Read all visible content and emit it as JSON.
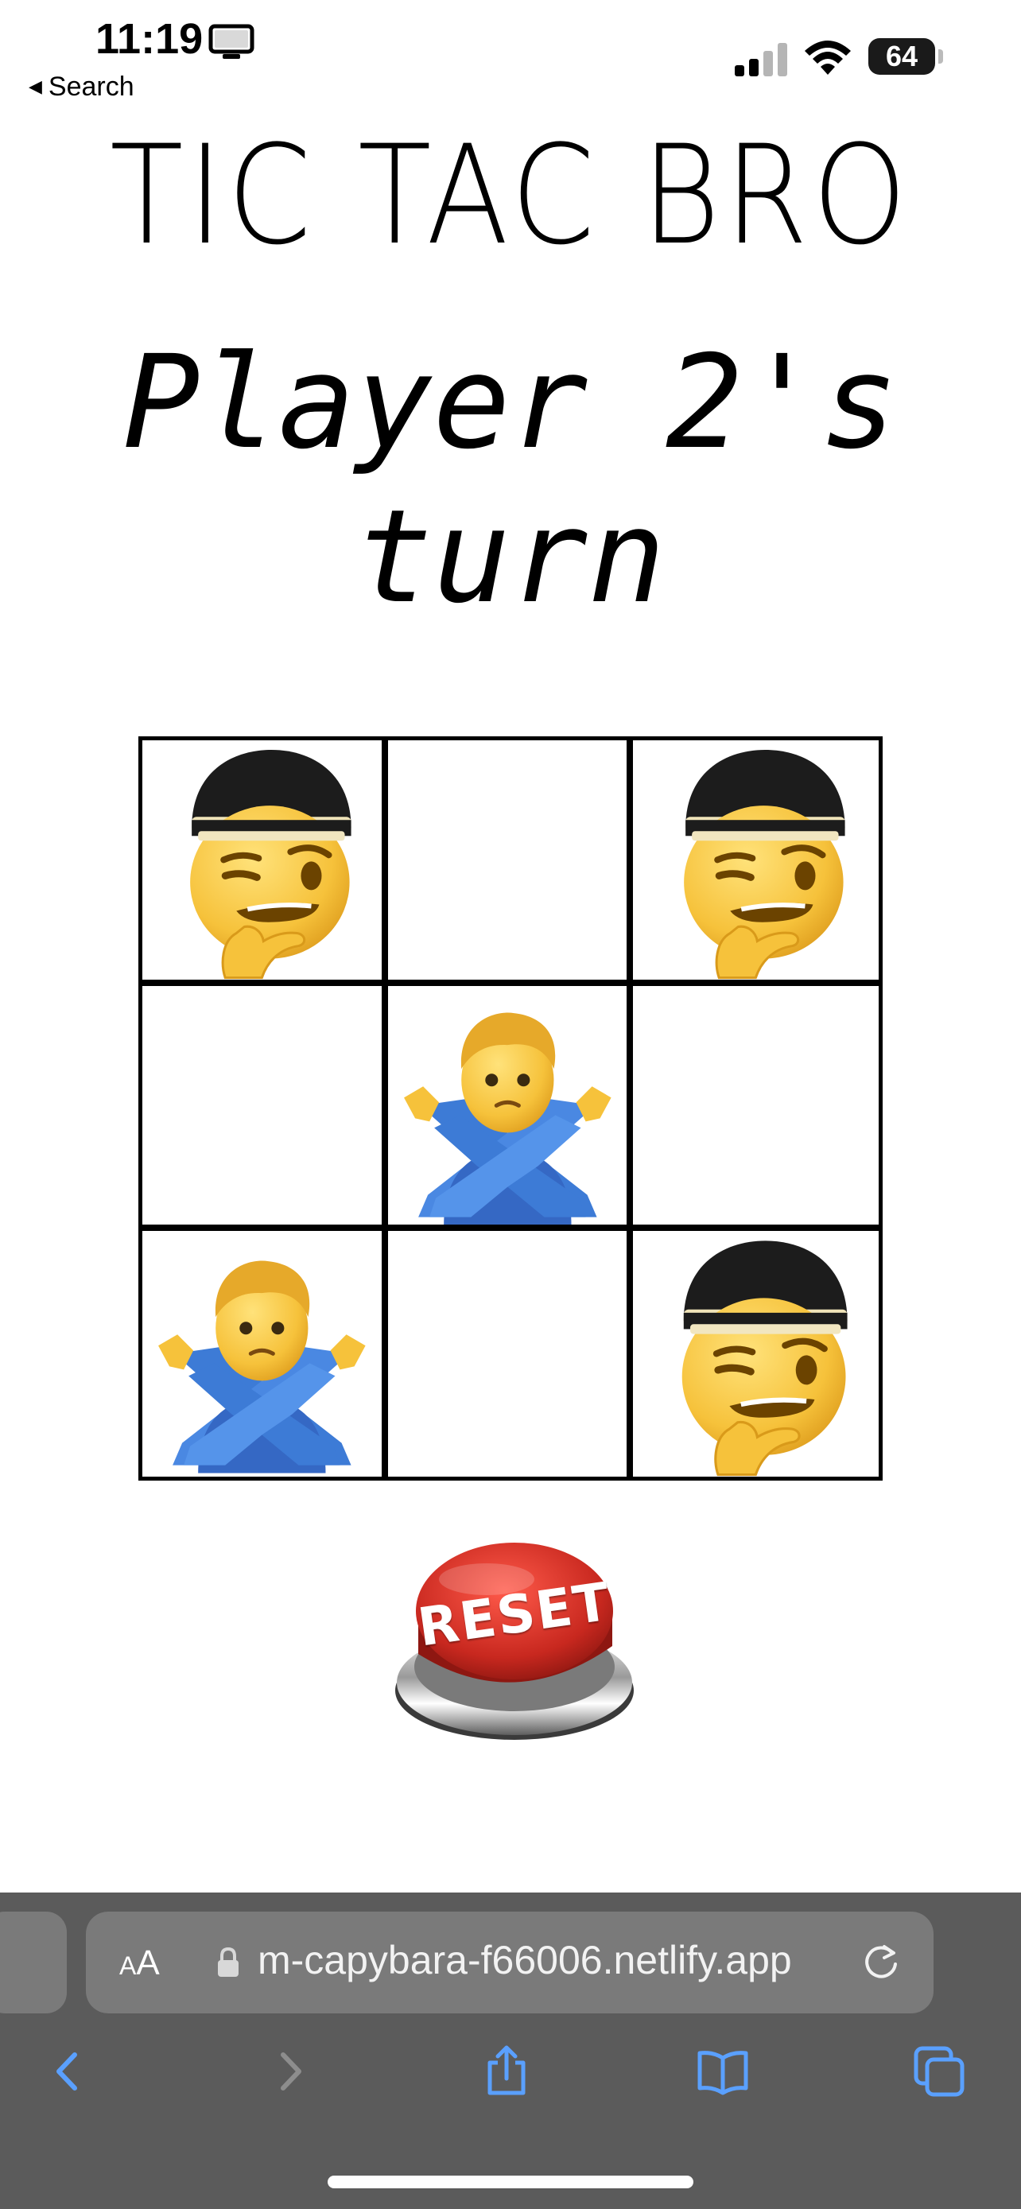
{
  "status_bar": {
    "time": "11:19",
    "back_label": "Search",
    "battery": "64",
    "icons": [
      "monitor-icon",
      "signal-icon",
      "wifi-icon",
      "battery-icon"
    ]
  },
  "game": {
    "title": "TIC TAC BRO",
    "turn_line1": "Player 2's",
    "turn_line2": "turn",
    "board": [
      [
        "thinking-bro",
        "",
        "thinking-bro"
      ],
      [
        "",
        "crossed-arms-man",
        ""
      ],
      [
        "crossed-arms-man",
        "",
        "thinking-bro"
      ]
    ],
    "reset_label": "RESET"
  },
  "browser": {
    "aa_label_big": "A",
    "aa_label_small": "A",
    "url": "m-capybara-f66006.netlify.app",
    "icons": [
      "lock-icon",
      "reload-icon",
      "back-arrow-icon",
      "forward-arrow-icon",
      "share-icon",
      "bookmarks-icon",
      "tabs-icon"
    ]
  },
  "colors": {
    "emoji_yellow": "#f6c23b",
    "shirt_blue": "#3d7bd6",
    "cap_black": "#1c1c1c",
    "reset_red": "#c8281f",
    "toolbar_gray": "#5b5b5b",
    "nav_blue": "#5aa0ff"
  }
}
